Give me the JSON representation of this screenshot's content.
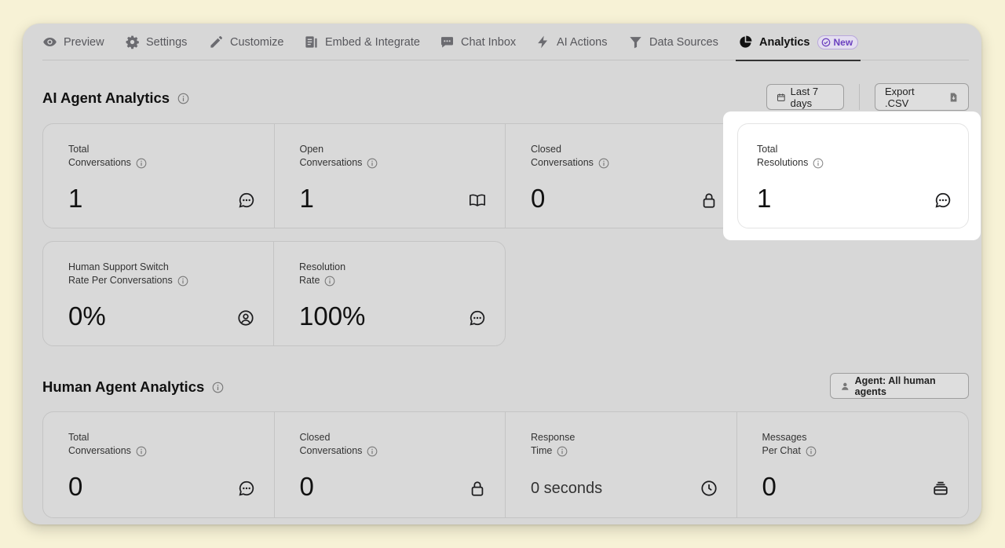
{
  "tabs": [
    {
      "label": "Preview",
      "icon": "eye-icon"
    },
    {
      "label": "Settings",
      "icon": "gear-icon"
    },
    {
      "label": "Customize",
      "icon": "pencil-icon"
    },
    {
      "label": "Embed & Integrate",
      "icon": "embed-icon"
    },
    {
      "label": "Chat Inbox",
      "icon": "chat-icon"
    },
    {
      "label": "AI Actions",
      "icon": "bolt-icon"
    },
    {
      "label": "Data Sources",
      "icon": "funnel-icon"
    },
    {
      "label": "Analytics",
      "icon": "pie-chart-icon",
      "active": true,
      "badge": "New"
    }
  ],
  "ai_section": {
    "title": "AI Agent Analytics",
    "date_range_label": "Last 7 days",
    "export_label": "Export .CSV",
    "cards": [
      {
        "label_line1": "Total",
        "label_line2": "Conversations",
        "value": "1",
        "icon": "chat-bubble-icon"
      },
      {
        "label_line1": "Open",
        "label_line2": "Conversations",
        "value": "1",
        "icon": "book-icon"
      },
      {
        "label_line1": "Closed",
        "label_line2": "Conversations",
        "value": "0",
        "icon": "lock-icon"
      },
      {
        "label_line1": "Total",
        "label_line2": "Resolutions",
        "value": "1",
        "icon": "chat-bubble-icon"
      }
    ],
    "cards_row2": [
      {
        "label_line1": "Human Support Switch",
        "label_line2": "Rate Per Conversations",
        "value": "0%",
        "icon": "user-circle-icon"
      },
      {
        "label_line1": "Resolution",
        "label_line2": "Rate",
        "value": "100%",
        "icon": "chat-bubble-icon"
      }
    ]
  },
  "human_section": {
    "title": "Human Agent Analytics",
    "agent_filter_label": "Agent: All human agents",
    "cards": [
      {
        "label_line1": "Total",
        "label_line2": "Conversations",
        "value": "0",
        "icon": "chat-bubble-icon"
      },
      {
        "label_line1": "Closed",
        "label_line2": "Conversations",
        "value": "0",
        "icon": "lock-icon"
      },
      {
        "label_line1": "Response",
        "label_line2": "Time",
        "value": "0 seconds",
        "icon": "clock-icon"
      },
      {
        "label_line1": "Messages",
        "label_line2": "Per Chat",
        "value": "0",
        "icon": "inbox-stack-icon"
      }
    ]
  },
  "colors": {
    "background": "#f7f2d6",
    "window": "#d7d7d7",
    "badge": "#6a3fbf",
    "highlight": "#ffffff"
  }
}
